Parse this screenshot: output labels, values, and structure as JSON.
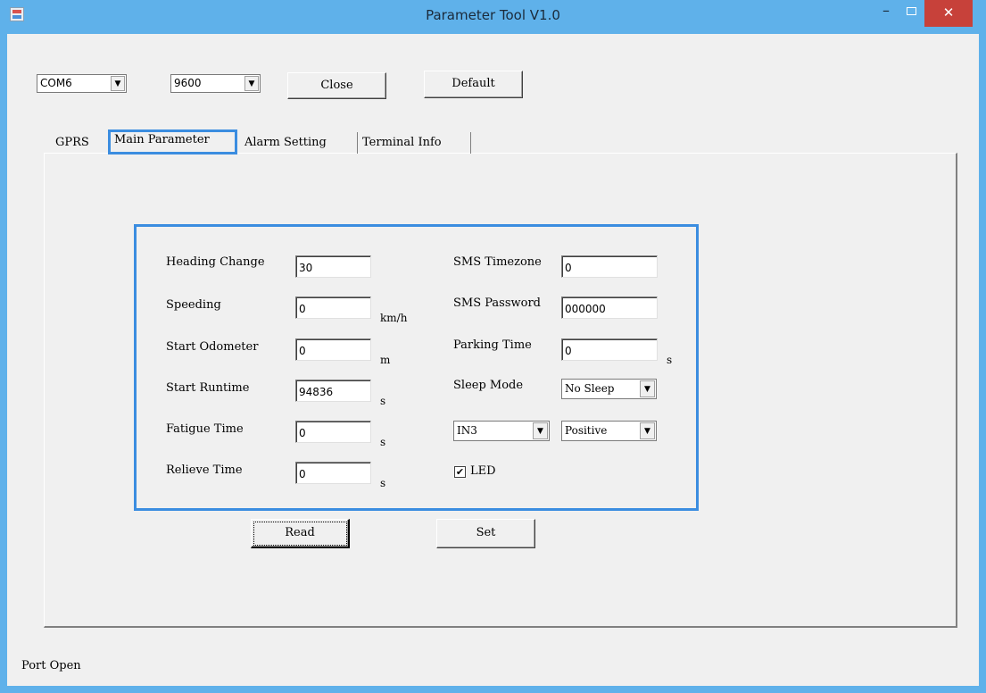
{
  "window": {
    "title": "Parameter Tool V1.0",
    "min_glyph": "–",
    "close_glyph": "✕"
  },
  "toolbar": {
    "port": "COM6",
    "baud": "9600",
    "close_label": "Close",
    "default_label": "Default"
  },
  "tabs": [
    {
      "label": "GPRS"
    },
    {
      "label": "Main Parameter"
    },
    {
      "label": "Alarm Setting"
    },
    {
      "label": "Terminal Info"
    }
  ],
  "params": {
    "heading_change": {
      "label": "Heading Change",
      "value": "30"
    },
    "speeding": {
      "label": "Speeding",
      "value": "0",
      "unit": "km/h"
    },
    "start_odometer": {
      "label": "Start Odometer",
      "value": "0",
      "unit": "m"
    },
    "start_runtime": {
      "label": "Start Runtime",
      "value": "94836",
      "unit": "s"
    },
    "fatigue_time": {
      "label": "Fatigue Time",
      "value": "0",
      "unit": "s"
    },
    "relieve_time": {
      "label": "Relieve Time",
      "value": "0",
      "unit": "s"
    },
    "sms_timezone": {
      "label": "SMS Timezone",
      "value": "0"
    },
    "sms_password": {
      "label": "SMS Password",
      "value": "000000"
    },
    "parking_time": {
      "label": "Parking Time",
      "value": "0",
      "unit": "s"
    },
    "sleep_mode": {
      "label": "Sleep Mode",
      "value": "No Sleep"
    },
    "input_select": {
      "value": "IN3"
    },
    "polarity_select": {
      "value": "Positive"
    },
    "led": {
      "label": "LED",
      "checked": "✔"
    }
  },
  "actions": {
    "read_label": "Read",
    "set_label": "Set"
  },
  "status": {
    "text": "Port Open"
  },
  "colors": {
    "titlebar": "#5fb1ea",
    "highlight": "#3b8de0",
    "close": "#c7413a"
  }
}
